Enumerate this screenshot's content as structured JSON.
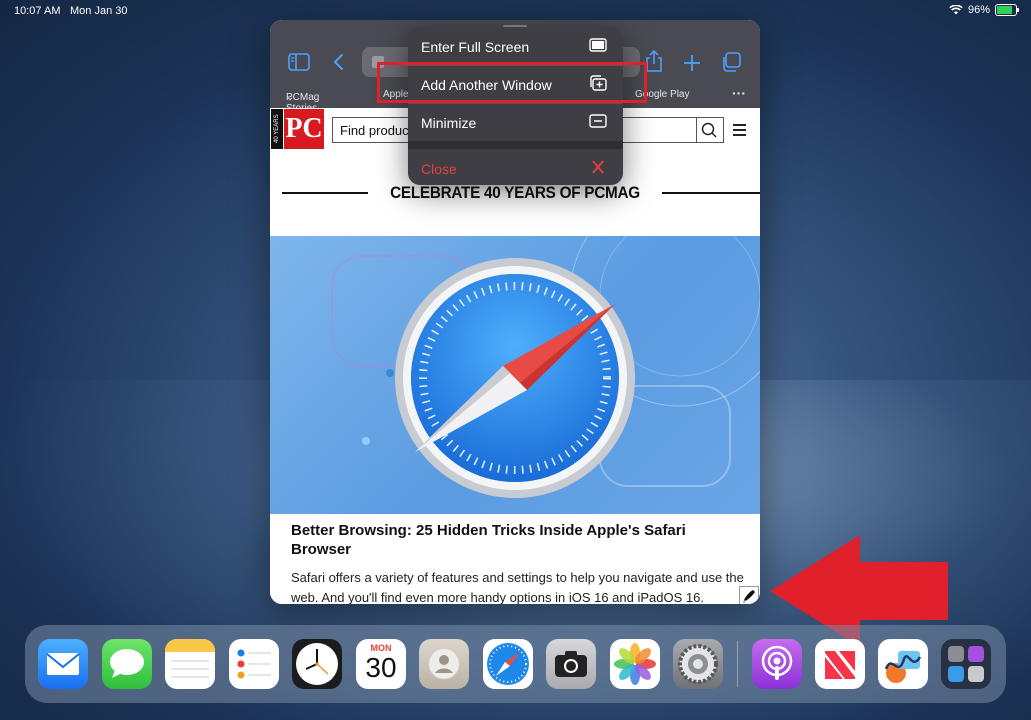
{
  "status": {
    "time": "10:07 AM",
    "date": "Mon Jan 30",
    "battery": "96%"
  },
  "toolbar": {
    "bookmarks": [
      "PCMag Stories",
      "Apple",
      "Google Play"
    ]
  },
  "page": {
    "logo_years": "40 YEARS",
    "logo_text": "PC",
    "search_placeholder": "Find produc",
    "banner": "CELEBRATE 40 YEARS OF PCMAG",
    "headline": "Better Browsing: 25 Hidden Tricks Inside Apple's Safari Browser",
    "excerpt": "Safari offers a variety of features and settings to help you navigate and use the web. And you'll find even more handy options in iOS 16 and iPadOS 16."
  },
  "menu": {
    "items": [
      {
        "label": "Enter Full Screen",
        "icon": "fullscreen-icon"
      },
      {
        "label": "Add Another Window",
        "icon": "add-window-icon"
      },
      {
        "label": "Minimize",
        "icon": "minimize-icon"
      },
      {
        "label": "Close",
        "icon": "close-icon"
      }
    ]
  },
  "dock": {
    "calendar_day": "MON",
    "calendar_date": "30",
    "apps": [
      "Mail",
      "Messages",
      "Notes",
      "Reminders",
      "Clock",
      "Calendar",
      "Contacts",
      "Safari",
      "Camera",
      "Photos",
      "Settings",
      "Podcasts",
      "News",
      "Freeform",
      "App Library"
    ]
  },
  "colors": {
    "accent": "#4ea0ff",
    "annotation": "#e0202a",
    "brand": "#d71920"
  }
}
